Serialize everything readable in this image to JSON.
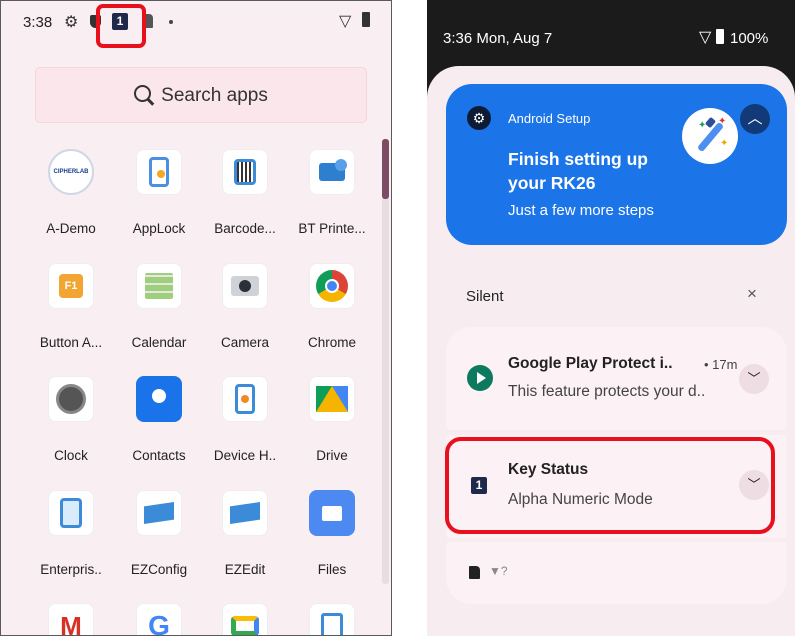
{
  "left": {
    "status": {
      "time": "3:38",
      "key_mode": "1"
    },
    "search": {
      "placeholder": "Search apps"
    },
    "apps": [
      {
        "label": "A-Demo",
        "icon": "cipherlab-icon",
        "text": "CIPHERLAB"
      },
      {
        "label": "AppLock",
        "icon": "applock-icon"
      },
      {
        "label": "Barcode...",
        "icon": "barcode-icon"
      },
      {
        "label": "BT Printe...",
        "icon": "bt-printer-icon"
      },
      {
        "label": "Button A...",
        "icon": "button-assignment-icon",
        "text": "F1"
      },
      {
        "label": "Calendar",
        "icon": "calendar-icon"
      },
      {
        "label": "Camera",
        "icon": "camera-icon"
      },
      {
        "label": "Chrome",
        "icon": "chrome-icon"
      },
      {
        "label": "Clock",
        "icon": "clock-icon"
      },
      {
        "label": "Contacts",
        "icon": "contacts-icon"
      },
      {
        "label": "Device H..",
        "icon": "device-health-icon"
      },
      {
        "label": "Drive",
        "icon": "drive-icon"
      },
      {
        "label": "Enterpris..",
        "icon": "enterprise-icon"
      },
      {
        "label": "EZConfig",
        "icon": "ezconfig-icon"
      },
      {
        "label": "EZEdit",
        "icon": "ezedit-icon"
      },
      {
        "label": "Files",
        "icon": "files-icon"
      },
      {
        "label": "",
        "icon": "gmail-icon",
        "text": "M"
      },
      {
        "label": "",
        "icon": "google-icon",
        "text": "G"
      },
      {
        "label": "",
        "icon": "meet-icon"
      },
      {
        "label": "",
        "icon": "nfc-icon"
      }
    ]
  },
  "right": {
    "status": {
      "time": "3:36 Mon, Aug 7",
      "battery": "100%"
    },
    "setup": {
      "app": "Android Setup",
      "title": "Finish setting up your RK26",
      "subtitle": "Just a few more steps"
    },
    "silent": {
      "label": "Silent",
      "close": "×"
    },
    "notifications": {
      "play_protect": {
        "title": "Google Play Protect i..",
        "time": "• 17m",
        "body": "This feature protects your d.."
      },
      "key_status": {
        "icon_text": "1",
        "title": "Key Status",
        "body": "Alpha Numeric Mode"
      }
    }
  },
  "colors": {
    "highlight": "#e8101c",
    "setup_card": "#1b74e8",
    "scroll_thumb": "#7d4b63"
  }
}
